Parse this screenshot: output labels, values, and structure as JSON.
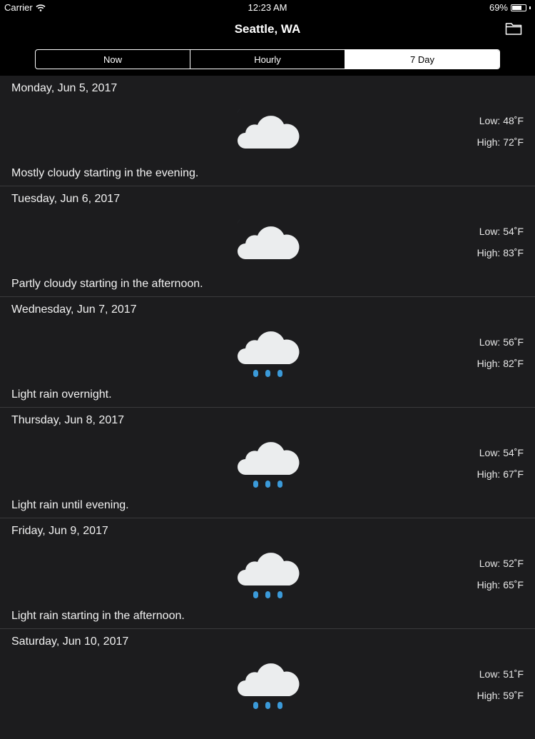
{
  "status_bar": {
    "carrier": "Carrier",
    "time": "12:23 AM",
    "battery": "69%"
  },
  "nav": {
    "title": "Seattle, WA",
    "folder_icon": "folder-icon"
  },
  "segments": [
    {
      "label": "Now",
      "selected": false
    },
    {
      "label": "Hourly",
      "selected": false
    },
    {
      "label": "7 Day",
      "selected": true
    }
  ],
  "days": [
    {
      "date": "Monday, Jun 5, 2017",
      "low": "Low: 48˚F",
      "high": "High: 72˚F",
      "summary": "Mostly cloudy starting in the evening.",
      "icon": "partly-cloudy-night-icon"
    },
    {
      "date": "Tuesday, Jun 6, 2017",
      "low": "Low: 54˚F",
      "high": "High: 83˚F",
      "summary": "Partly cloudy starting in the afternoon.",
      "icon": "partly-cloudy-night-icon"
    },
    {
      "date": "Wednesday, Jun 7, 2017",
      "low": "Low: 56˚F",
      "high": "High: 82˚F",
      "summary": "Light rain overnight.",
      "icon": "rain-icon"
    },
    {
      "date": "Thursday, Jun 8, 2017",
      "low": "Low: 54˚F",
      "high": "High: 67˚F",
      "summary": "Light rain until evening.",
      "icon": "rain-icon"
    },
    {
      "date": "Friday, Jun 9, 2017",
      "low": "Low: 52˚F",
      "high": "High: 65˚F",
      "summary": "Light rain starting in the afternoon.",
      "icon": "rain-icon"
    },
    {
      "date": "Saturday, Jun 10, 2017",
      "low": "Low: 51˚F",
      "high": "High: 59˚F",
      "summary": "",
      "icon": "rain-icon"
    }
  ],
  "colors": {
    "background": "#1c1c1e",
    "cloud": "#ebedee",
    "rain_drop": "#3b9ad9",
    "moon": "#4b5b69"
  }
}
